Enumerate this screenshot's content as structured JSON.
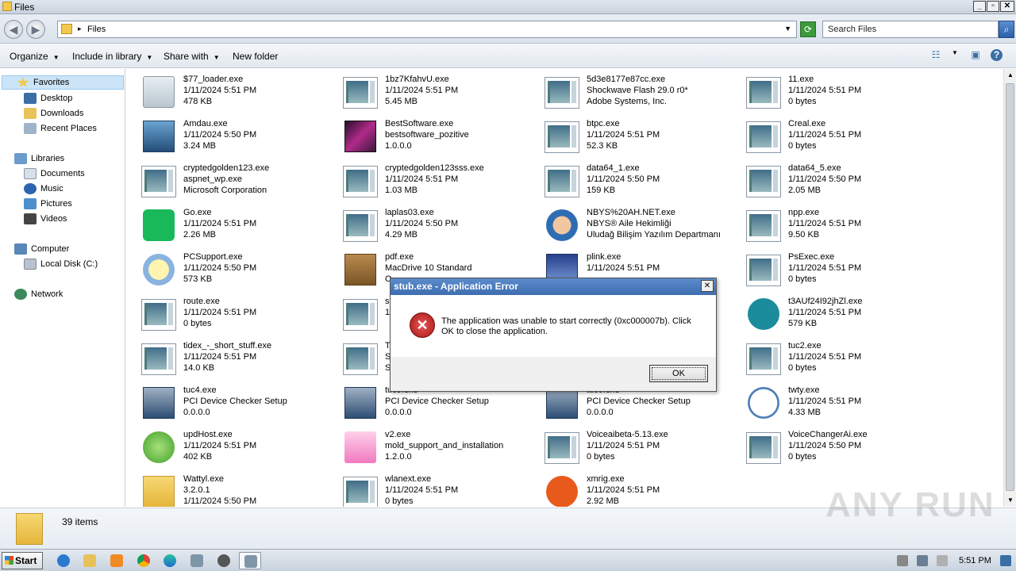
{
  "window": {
    "title": "Files"
  },
  "address": {
    "crumb": "Files",
    "search_placeholder": "Search Files"
  },
  "toolbar": {
    "organize": "Organize",
    "include_in_library": "Include in library",
    "share_with": "Share with",
    "new_folder": "New folder"
  },
  "nav": {
    "favorites": "Favorites",
    "desktop": "Desktop",
    "downloads": "Downloads",
    "recent_places": "Recent Places",
    "libraries": "Libraries",
    "documents": "Documents",
    "music": "Music",
    "pictures": "Pictures",
    "videos": "Videos",
    "computer": "Computer",
    "local_disk": "Local Disk (C:)",
    "network": "Network"
  },
  "files": [
    {
      "name": "$77_loader.exe",
      "l2": "1/11/2024 5:51 PM",
      "l3": "478 KB",
      "icon": "installer-icon"
    },
    {
      "name": "1bz7KfahvU.exe",
      "l2": "1/11/2024 5:51 PM",
      "l3": "5.45 MB",
      "icon": "exe-icon"
    },
    {
      "name": "5d3e8177e87cc.exe",
      "l2": "Shockwave Flash 29.0 r0*",
      "l3": "Adobe Systems, Inc.",
      "icon": "exe-icon"
    },
    {
      "name": "11.exe",
      "l2": "1/11/2024 5:51 PM",
      "l3": "0 bytes",
      "icon": "exe-icon"
    },
    {
      "name": "Amdau.exe",
      "l2": "1/11/2024 5:50 PM",
      "l3": "3.24 MB",
      "icon": "box-icon"
    },
    {
      "name": "BestSoftware.exe",
      "l2": "bestsoftware_pozitive",
      "l3": "1.0.0.0",
      "icon": "software-icon"
    },
    {
      "name": "btpc.exe",
      "l2": "1/11/2024 5:51 PM",
      "l3": "52.3 KB",
      "icon": "exe-icon"
    },
    {
      "name": "Creal.exe",
      "l2": "1/11/2024 5:51 PM",
      "l3": "0 bytes",
      "icon": "exe-icon"
    },
    {
      "name": "cryptedgolden123.exe",
      "l2": "aspnet_wp.exe",
      "l3": "Microsoft Corporation",
      "icon": "exe-icon"
    },
    {
      "name": "cryptedgolden123sss.exe",
      "l2": "1/11/2024 5:51 PM",
      "l3": "1.03 MB",
      "icon": "exe-icon"
    },
    {
      "name": "data64_1.exe",
      "l2": "1/11/2024 5:50 PM",
      "l3": "159 KB",
      "icon": "exe-icon"
    },
    {
      "name": "data64_5.exe",
      "l2": "1/11/2024 5:50 PM",
      "l3": "2.05 MB",
      "icon": "exe-icon"
    },
    {
      "name": "Go.exe",
      "l2": "1/11/2024 5:51 PM",
      "l3": "2.26 MB",
      "icon": "green-t-icon"
    },
    {
      "name": "laplas03.exe",
      "l2": "1/11/2024 5:50 PM",
      "l3": "4.29 MB",
      "icon": "exe-icon"
    },
    {
      "name": "NBYS%20AH.NET.exe",
      "l2": "NBYS® Aile Hekimliği",
      "l3": "Uludağ Bilişim Yazılım Departmanı",
      "icon": "doctor-icon"
    },
    {
      "name": "npp.exe",
      "l2": "1/11/2024 5:51 PM",
      "l3": "9.50 KB",
      "icon": "exe-icon"
    },
    {
      "name": "PCSupport.exe",
      "l2": "1/11/2024 5:50 PM",
      "l3": "573 KB",
      "icon": "magnifier-icon"
    },
    {
      "name": "pdf.exe",
      "l2": "MacDrive 10 Standard",
      "l3": "O",
      "icon": "package-icon"
    },
    {
      "name": "plink.exe",
      "l2": "1/11/2024 5:51 PM",
      "l3": "",
      "icon": "plink-icon"
    },
    {
      "name": "PsExec.exe",
      "l2": "1/11/2024 5:51 PM",
      "l3": "0 bytes",
      "icon": "exe-icon"
    },
    {
      "name": "route.exe",
      "l2": "1/11/2024 5:51 PM",
      "l3": "0 bytes",
      "icon": "exe-icon"
    },
    {
      "name": "se",
      "l2": "1,",
      "l3": "",
      "icon": "exe-icon"
    },
    {
      "name": "",
      "l2": "",
      "l3": "",
      "icon": "none"
    },
    {
      "name": "t3AUf24I92jhZl.exe",
      "l2": "1/11/2024 5:51 PM",
      "l3": "579 KB",
      "icon": "surfshark-icon"
    },
    {
      "name": "tidex_-_short_stuff.exe",
      "l2": "1/11/2024 5:51 PM",
      "l3": "14.0 KB",
      "icon": "exe-icon"
    },
    {
      "name": "T.",
      "l2": "Si",
      "l3": "Si",
      "icon": "exe-icon"
    },
    {
      "name": "",
      "l2": "",
      "l3": "",
      "icon": "none"
    },
    {
      "name": "tuc2.exe",
      "l2": "1/11/2024 5:51 PM",
      "l3": "0 bytes",
      "icon": "exe-icon"
    },
    {
      "name": "tuc4.exe",
      "l2": "PCI Device Checker Setup",
      "l3": "0.0.0.0",
      "icon": "setup-icon"
    },
    {
      "name": "tuc5.exe",
      "l2": "PCI Device Checker Setup",
      "l3": "0.0.0.0",
      "icon": "setup-icon"
    },
    {
      "name": "tuc6.exe",
      "l2": "PCI Device Checker Setup",
      "l3": "0.0.0.0",
      "icon": "setup-icon"
    },
    {
      "name": "twty.exe",
      "l2": "1/11/2024 5:51 PM",
      "l3": "4.33 MB",
      "icon": "clock-icon"
    },
    {
      "name": "updHost.exe",
      "l2": "1/11/2024 5:51 PM",
      "l3": "402 KB",
      "icon": "green-circle-icon"
    },
    {
      "name": "v2.exe",
      "l2": "mold_support_and_installation",
      "l3": "1.2.0.0",
      "icon": "pink-doc-icon"
    },
    {
      "name": "Voiceaibeta-5.13.exe",
      "l2": "1/11/2024 5:51 PM",
      "l3": "0 bytes",
      "icon": "exe-icon"
    },
    {
      "name": "VoiceChangerAi.exe",
      "l2": "1/11/2024 5:50 PM",
      "l3": "0 bytes",
      "icon": "exe-icon"
    },
    {
      "name": "Wattyl.exe",
      "l2": "3.2.0.1",
      "l3": "1/11/2024 5:50 PM",
      "icon": "folder-icon"
    },
    {
      "name": "wlanext.exe",
      "l2": "1/11/2024 5:51 PM",
      "l3": "0 bytes",
      "icon": "exe-icon"
    },
    {
      "name": "xmrig.exe",
      "l2": "1/11/2024 5:51 PM",
      "l3": "2.92 MB",
      "icon": "xmrig-icon"
    }
  ],
  "details": {
    "count": "39 items"
  },
  "dialog": {
    "title": "stub.exe - Application Error",
    "message": "The application was unable to start correctly (0xc000007b). Click OK to close the application.",
    "ok": "OK"
  },
  "taskbar": {
    "start": "Start",
    "clock": "5:51 PM"
  },
  "watermark": "ANY RUN"
}
